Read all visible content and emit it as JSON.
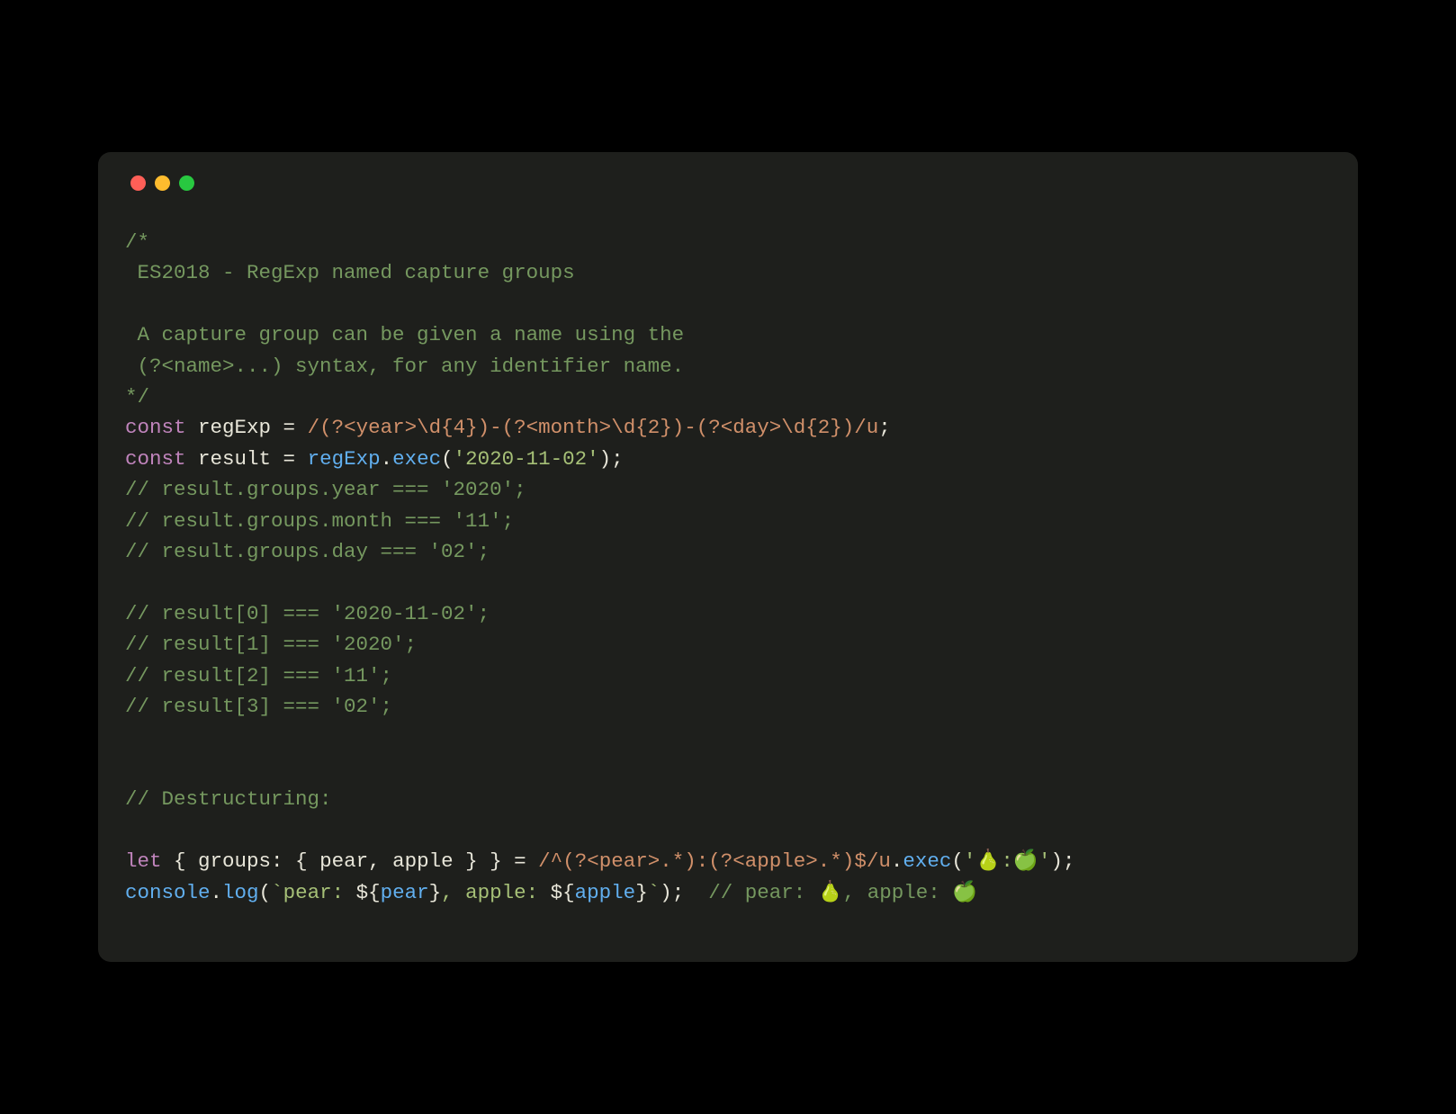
{
  "window": {
    "traffic_lights": {
      "red": "#ff5f57",
      "yellow": "#febc2e",
      "green": "#28c840"
    }
  },
  "code": {
    "c1": "/*",
    "c2": " ES2018 - RegExp named capture groups",
    "c3": "",
    "c4": " A capture group can be given a name using the",
    "c5": " (?<name>...) syntax, for any identifier name.",
    "c6": "*/",
    "l7_kw1": "const",
    "l7_var": " regExp ",
    "l7_eq": "= ",
    "l7_rx_open": "/",
    "l7_group1_open": "(?<year>",
    "l7_d4": "\\d{4}",
    "l7_group1_close": ")",
    "l7_h1": "-",
    "l7_group2_open": "(?<month>",
    "l7_d2a": "\\d{2}",
    "l7_group2_close": ")",
    "l7_h2": "-",
    "l7_group3_open": "(?<day>",
    "l7_d2b": "\\d{2}",
    "l7_group3_close": ")",
    "l7_rx_close": "/u",
    "l7_end": ";",
    "l8_kw": "const",
    "l8_var": " result ",
    "l8_eq": "= ",
    "l8_obj": "regExp",
    "l8_dot": ".",
    "l8_fn": "exec",
    "l8_open": "(",
    "l8_str": "'2020-11-02'",
    "l8_close": ");",
    "c9": "// result.groups.year === '2020';",
    "c10": "// result.groups.month === '11';",
    "c11": "// result.groups.day === '02';",
    "c12": "",
    "c13": "// result[0] === '2020-11-02';",
    "c14": "// result[1] === '2020';",
    "c15": "// result[2] === '11';",
    "c16": "// result[3] === '02';",
    "c17": "",
    "c18": "",
    "c19": "// Destructuring:",
    "c20": "",
    "l21_kw": "let",
    "l21_destruct_a": " { ",
    "l21_groups": "groups",
    "l21_colon": ": ",
    "l21_destruct_b": "{ ",
    "l21_pear": "pear",
    "l21_comma": ", ",
    "l21_apple": "apple",
    "l21_destruct_c": " } } ",
    "l21_eq": "= ",
    "l21_rx_open": "/",
    "l21_caret": "^",
    "l21_gp_open": "(?<pear>",
    "l21_gp_dot": ".*",
    "l21_gp_close": ")",
    "l21_col_lit": ":",
    "l21_ga_open": "(?<apple>",
    "l21_ga_dot": ".*",
    "l21_ga_close": ")",
    "l21_dollar": "$",
    "l21_rx_close": "/u",
    "l21_dot": ".",
    "l21_fn": "exec",
    "l21_open": "(",
    "l21_str": "'🍐:🍏'",
    "l21_close": ");",
    "l22_obj": "console",
    "l22_dot": ".",
    "l22_fn": "log",
    "l22_open": "(",
    "l22_bt1": "`pear: ",
    "l22_i1_open": "${",
    "l22_i1_var": "pear",
    "l22_i1_close": "}",
    "l22_mid": ", apple: ",
    "l22_i2_open": "${",
    "l22_i2_var": "apple",
    "l22_i2_close": "}",
    "l22_bt2": "`",
    "l22_close": ");  ",
    "l22_comment": "// pear: 🍐, apple: 🍏"
  }
}
